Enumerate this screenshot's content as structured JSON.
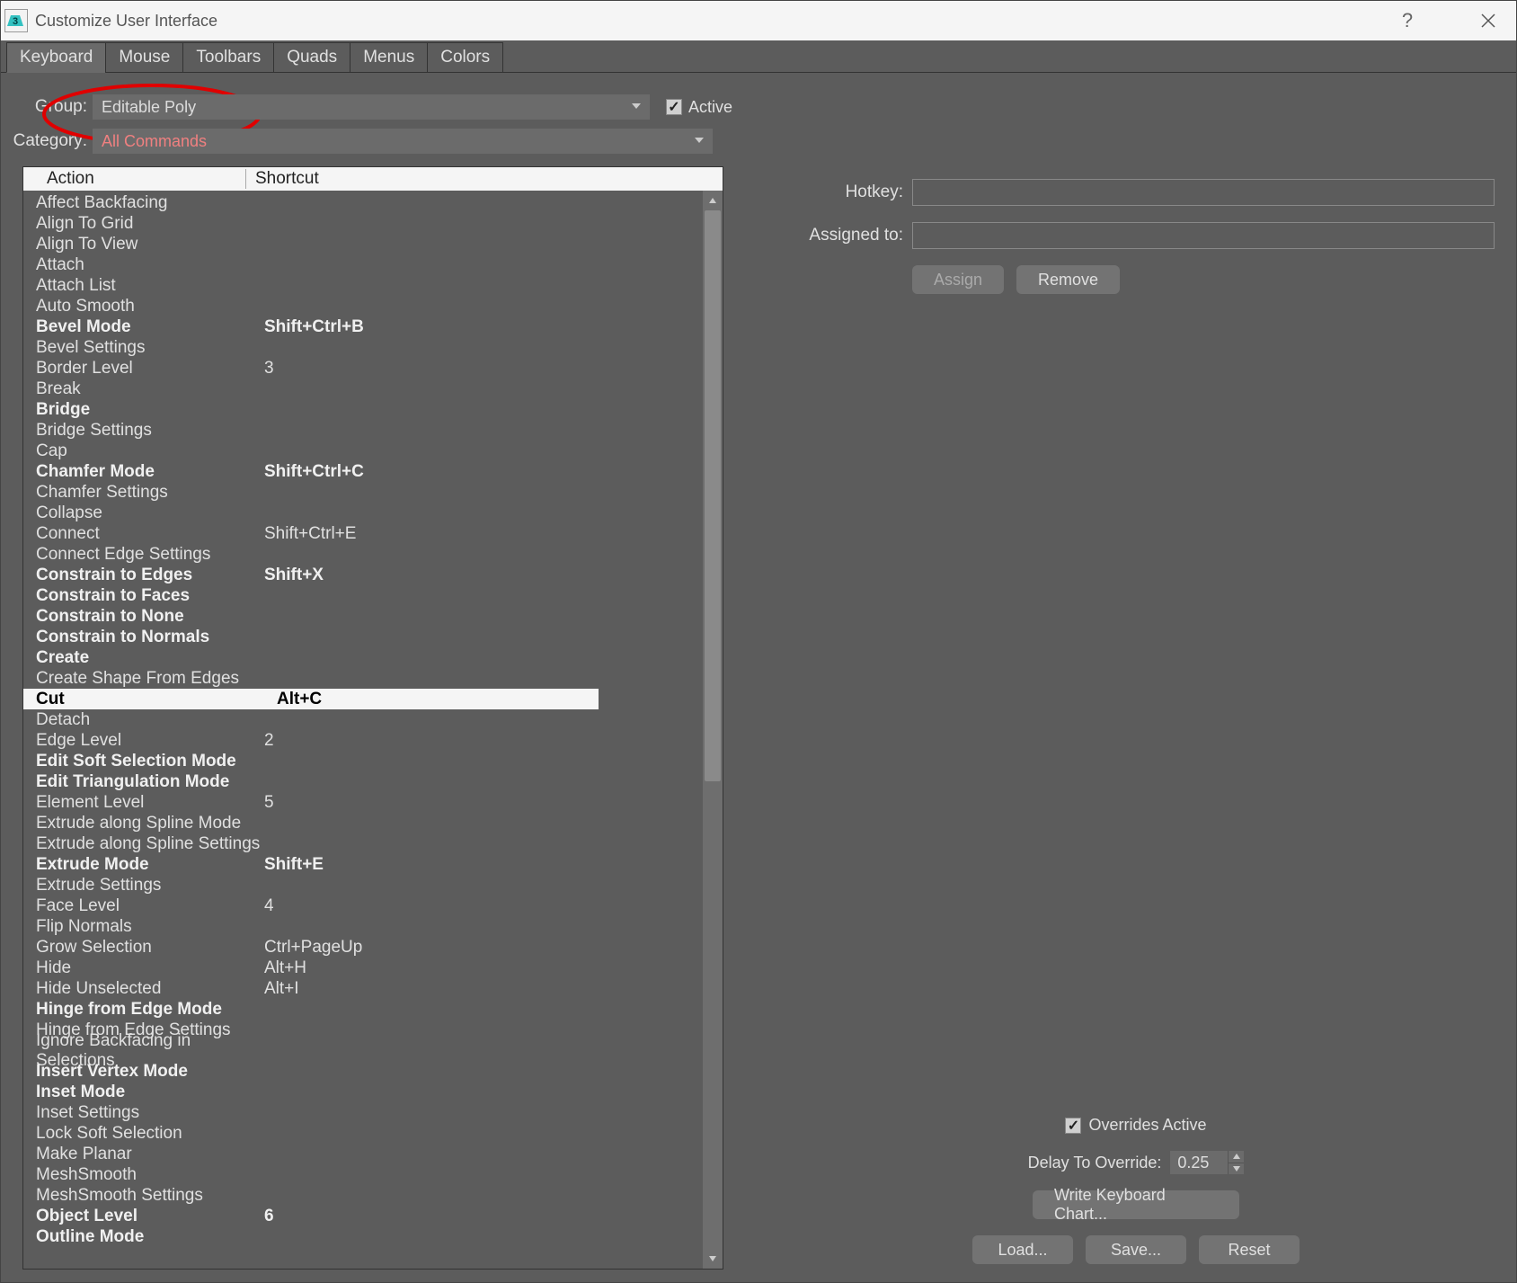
{
  "window_title": "Customize User Interface",
  "tabs": [
    "Keyboard",
    "Mouse",
    "Toolbars",
    "Quads",
    "Menus",
    "Colors"
  ],
  "active_tab": "Keyboard",
  "group_label": "Group:",
  "group_value": "Editable Poly",
  "active_check_label": "Active",
  "category_label": "Category:",
  "category_value": "All Commands",
  "list_headers": {
    "action": "Action",
    "shortcut": "Shortcut"
  },
  "actions": [
    {
      "name": "Affect Backfacing",
      "shortcut": "",
      "bold": false
    },
    {
      "name": "Align To Grid",
      "shortcut": "",
      "bold": false
    },
    {
      "name": "Align To View",
      "shortcut": "",
      "bold": false
    },
    {
      "name": "Attach",
      "shortcut": "",
      "bold": false
    },
    {
      "name": "Attach List",
      "shortcut": "",
      "bold": false
    },
    {
      "name": "Auto Smooth",
      "shortcut": "",
      "bold": false
    },
    {
      "name": "Bevel Mode",
      "shortcut": "Shift+Ctrl+B",
      "bold": true
    },
    {
      "name": "Bevel Settings",
      "shortcut": "",
      "bold": false
    },
    {
      "name": "Border Level",
      "shortcut": "3",
      "bold": false
    },
    {
      "name": "Break",
      "shortcut": "",
      "bold": false
    },
    {
      "name": "Bridge",
      "shortcut": "",
      "bold": true
    },
    {
      "name": "Bridge Settings",
      "shortcut": "",
      "bold": false
    },
    {
      "name": "Cap",
      "shortcut": "",
      "bold": false
    },
    {
      "name": "Chamfer Mode",
      "shortcut": "Shift+Ctrl+C",
      "bold": true
    },
    {
      "name": "Chamfer Settings",
      "shortcut": "",
      "bold": false
    },
    {
      "name": "Collapse",
      "shortcut": "",
      "bold": false
    },
    {
      "name": "Connect",
      "shortcut": "Shift+Ctrl+E",
      "bold": false
    },
    {
      "name": "Connect Edge Settings",
      "shortcut": "",
      "bold": false
    },
    {
      "name": "Constrain to Edges",
      "shortcut": "Shift+X",
      "bold": true
    },
    {
      "name": "Constrain to Faces",
      "shortcut": "",
      "bold": true
    },
    {
      "name": "Constrain to None",
      "shortcut": "",
      "bold": true
    },
    {
      "name": "Constrain to Normals",
      "shortcut": "",
      "bold": true
    },
    {
      "name": "Create",
      "shortcut": "",
      "bold": true
    },
    {
      "name": "Create Shape From Edges",
      "shortcut": "",
      "bold": false
    },
    {
      "name": "Cut",
      "shortcut": "Alt+C",
      "bold": true,
      "selected": true
    },
    {
      "name": "Detach",
      "shortcut": "",
      "bold": false
    },
    {
      "name": "Edge Level",
      "shortcut": "2",
      "bold": false
    },
    {
      "name": "Edit Soft Selection Mode",
      "shortcut": "",
      "bold": true
    },
    {
      "name": "Edit Triangulation Mode",
      "shortcut": "",
      "bold": true
    },
    {
      "name": "Element Level",
      "shortcut": "5",
      "bold": false
    },
    {
      "name": "Extrude along Spline Mode",
      "shortcut": "",
      "bold": false
    },
    {
      "name": "Extrude along Spline Settings",
      "shortcut": "",
      "bold": false
    },
    {
      "name": "Extrude Mode",
      "shortcut": "Shift+E",
      "bold": true
    },
    {
      "name": "Extrude Settings",
      "shortcut": "",
      "bold": false
    },
    {
      "name": "Face Level",
      "shortcut": "4",
      "bold": false
    },
    {
      "name": "Flip Normals",
      "shortcut": "",
      "bold": false
    },
    {
      "name": "Grow Selection",
      "shortcut": "Ctrl+PageUp",
      "bold": false
    },
    {
      "name": "Hide",
      "shortcut": "Alt+H",
      "bold": false
    },
    {
      "name": "Hide Unselected",
      "shortcut": "Alt+I",
      "bold": false
    },
    {
      "name": "Hinge from Edge Mode",
      "shortcut": "",
      "bold": true
    },
    {
      "name": "Hinge from Edge Settings",
      "shortcut": "",
      "bold": false
    },
    {
      "name": "Ignore Backfacing in Selections",
      "shortcut": "",
      "bold": false
    },
    {
      "name": "Insert Vertex Mode",
      "shortcut": "",
      "bold": true
    },
    {
      "name": "Inset Mode",
      "shortcut": "",
      "bold": true
    },
    {
      "name": "Inset Settings",
      "shortcut": "",
      "bold": false
    },
    {
      "name": "Lock Soft Selection",
      "shortcut": "",
      "bold": false
    },
    {
      "name": "Make Planar",
      "shortcut": "",
      "bold": false
    },
    {
      "name": "MeshSmooth",
      "shortcut": "",
      "bold": false
    },
    {
      "name": "MeshSmooth Settings",
      "shortcut": "",
      "bold": false
    },
    {
      "name": "Object Level",
      "shortcut": "6",
      "bold": true
    },
    {
      "name": "Outline Mode",
      "shortcut": "",
      "bold": true
    }
  ],
  "hotkey_label": "Hotkey:",
  "assigned_label": "Assigned to:",
  "assign_btn": "Assign",
  "remove_btn": "Remove",
  "overrides_label": "Overrides Active",
  "delay_label": "Delay To Override:",
  "delay_value": "0.25",
  "write_chart_btn": "Write Keyboard Chart...",
  "load_btn": "Load...",
  "save_btn": "Save...",
  "reset_btn": "Reset"
}
